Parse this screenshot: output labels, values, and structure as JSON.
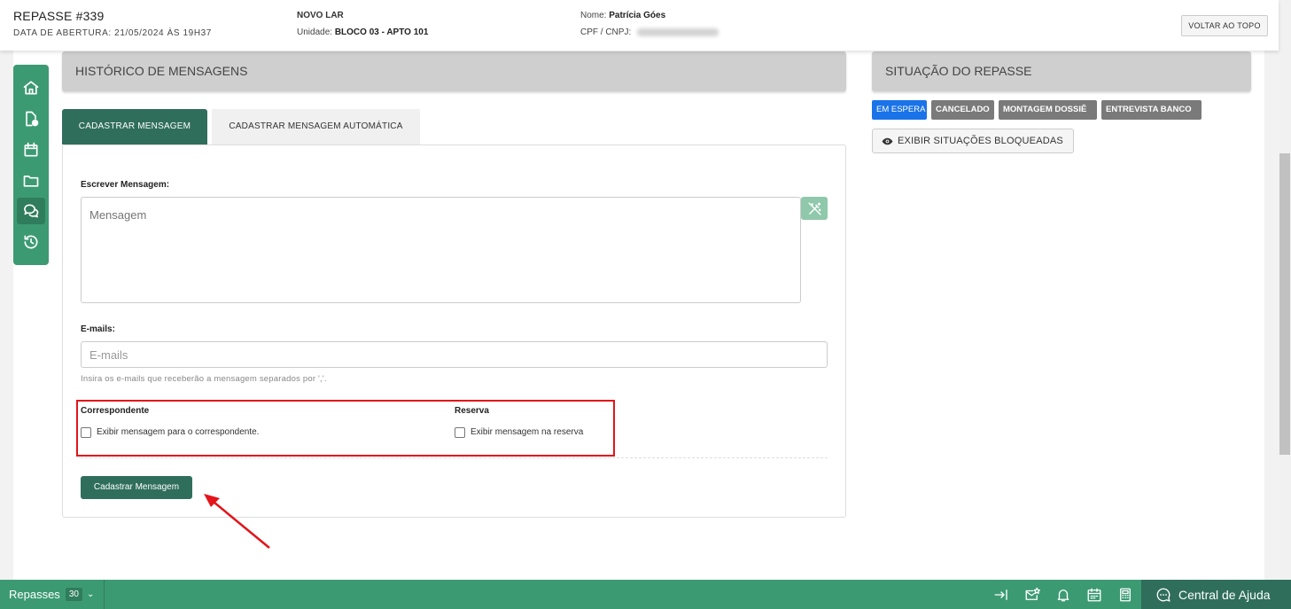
{
  "header": {
    "title": "REPASSE #339",
    "opening": "DATA DE ABERTURA: 21/05/2024 ÀS 19H37",
    "enterprise": "NOVO LAR",
    "unit_label": "Unidade:",
    "unit_value": "BLOCO 03 - APTO 101",
    "name_label": "Nome:",
    "name_value": "Patrícia Góes",
    "cpf_label": "CPF / CNPJ:",
    "back_to_top": "VOLTAR AO TOPO"
  },
  "sidebar": {
    "items": [
      {
        "name": "home-icon",
        "active": false
      },
      {
        "name": "document-badge-icon",
        "active": false
      },
      {
        "name": "calendar-icon",
        "active": false
      },
      {
        "name": "folder-icon",
        "active": false
      },
      {
        "name": "chat-icon",
        "active": true
      },
      {
        "name": "history-icon",
        "active": false
      }
    ]
  },
  "messages_panel": {
    "title": "HISTÓRICO DE MENSAGENS",
    "tabs": [
      {
        "label": "CADASTRAR MENSAGEM",
        "active": true
      },
      {
        "label": "CADASTRAR MENSAGEM AUTOMÁTICA",
        "active": false
      }
    ],
    "write_label": "Escrever Mensagem:",
    "message_placeholder": "Mensagem",
    "emails_label": "E-mails:",
    "emails_placeholder": "E-mails",
    "emails_hint": "Insira os e-mails que receberão a mensagem separados por ','.",
    "correspondent_title": "Correspondente",
    "correspondent_checkbox": "Exibir mensagem para o correspondente.",
    "reserve_title": "Reserva",
    "reserve_checkbox": "Exibir mensagem na reserva",
    "submit_label": "Cadastrar Mensagem"
  },
  "status_panel": {
    "title": "SITUAÇÃO DO REPASSE",
    "badges": [
      {
        "label": "EM ESPERA",
        "color": "#1a73e8"
      },
      {
        "label": "CANCELADO",
        "color": "#7a7a7a"
      },
      {
        "label": "MONTAGEM DOSSIÊ",
        "color": "#7a7a7a"
      },
      {
        "label": "ENTREVISTA BANCO",
        "color": "#7a7a7a"
      }
    ],
    "show_blocked": "EXIBIR SITUAÇÕES BLOQUEADAS"
  },
  "bottom_bar": {
    "label": "Repasses",
    "count": "30",
    "help_label": "Central de Ajuda"
  },
  "colors": {
    "primary_green": "#3c9a73",
    "dark_green": "#2f6e5b",
    "highlight_red": "#e3141a"
  }
}
